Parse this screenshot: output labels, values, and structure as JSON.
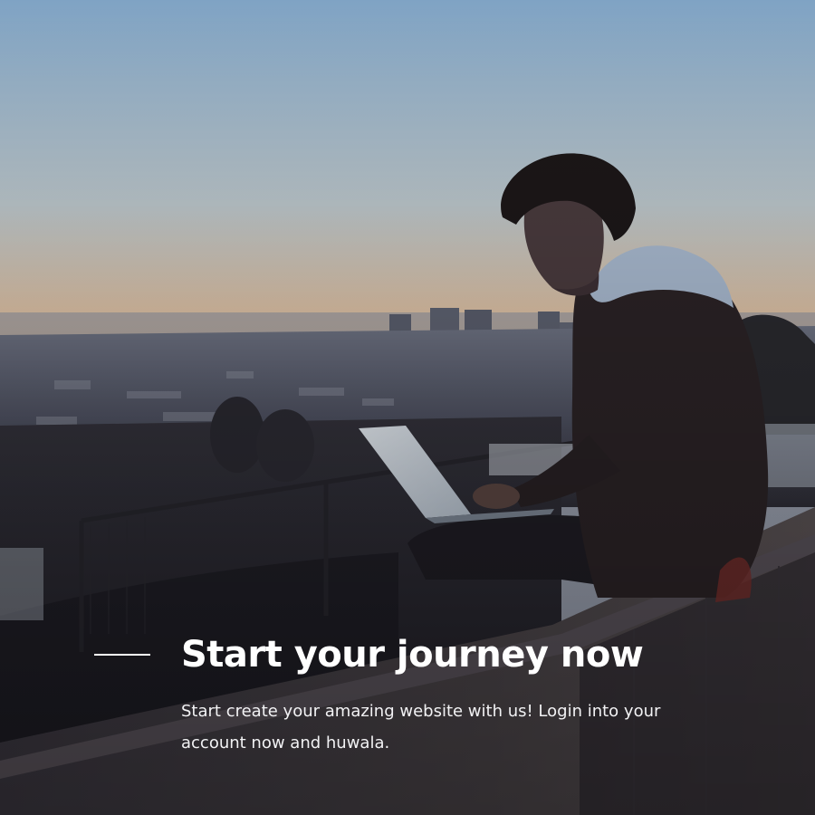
{
  "hero": {
    "title": "Start your journey now",
    "description": "Start create your amazing website with us! Login into your account now and huwala."
  },
  "colors": {
    "sky_top": "#7fa3c4",
    "sky_horizon": "#f1a86a",
    "city_haze": "#5d6272",
    "foreground_dark": "#22212a",
    "caption_text": "#ffffff"
  }
}
